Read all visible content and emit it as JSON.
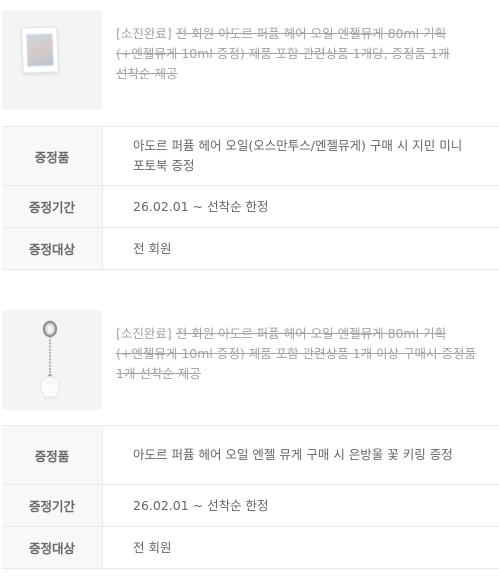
{
  "gifts": [
    {
      "title_prefix": "[소진완료]",
      "title_strike": "전 회원 아도르 퍼퓸 헤어 오일 엔젤뮤게 80ml 기획 (+엔젤뮤게 10ml 증정) 제품 포함 관련상품 1개당, 증정품 1개 선착순 제공",
      "rows": [
        {
          "label": "증정품",
          "value": "아도르 퍼퓸 헤어 오일(오스만투스/엔젤뮤게) 구매 시 지민 미니 포토북 증정"
        },
        {
          "label": "증정기간",
          "value": "26.02.01 ~ 선착순 한정"
        },
        {
          "label": "증정대상",
          "value": "전 회원"
        }
      ]
    },
    {
      "title_prefix": "[소진완료]",
      "title_strike": "전 회원 아도르 퍼퓸 헤어 오일 엔젤뮤게 80ml 기획 (+엔젤뮤게 10ml 증정) 제품 포함 관련상품 1개 이상 구매시 증정품 1개 선착순 제공",
      "rows": [
        {
          "label": "증정품",
          "value": "아도르 퍼퓸 헤어 오일 엔젤 뮤게 구매 시 은방울 꽃 키링 증정"
        },
        {
          "label": "증정기간",
          "value": "26.02.01 ~ 선착순 한정"
        },
        {
          "label": "증정대상",
          "value": "전 회원"
        }
      ]
    }
  ]
}
